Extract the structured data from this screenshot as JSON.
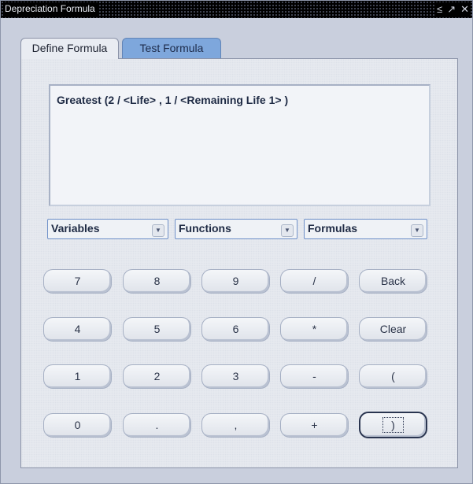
{
  "window": {
    "title": "Depreciation Formula",
    "controls": [
      "≤",
      "↗",
      "✕"
    ]
  },
  "tabs": [
    {
      "label": "Define Formula",
      "active": true
    },
    {
      "label": "Test Formula",
      "active": false
    }
  ],
  "formula": {
    "text": "Greatest (2 / <Life> , 1 / <Remaining Life 1> )"
  },
  "dropdowns": [
    {
      "label": "Variables"
    },
    {
      "label": "Functions"
    },
    {
      "label": "Formulas"
    }
  ],
  "keypad": {
    "rows": [
      [
        "7",
        "8",
        "9",
        "/",
        "Back"
      ],
      [
        "4",
        "5",
        "6",
        "*",
        "Clear"
      ],
      [
        "1",
        "2",
        "3",
        "-",
        "("
      ],
      [
        "0",
        ".",
        ",",
        "+",
        ")"
      ]
    ]
  },
  "colors": {
    "tab_active": "#e9ecf2",
    "tab_inactive": "#7ea7dc",
    "dropdown_border": "#6f90c8"
  }
}
